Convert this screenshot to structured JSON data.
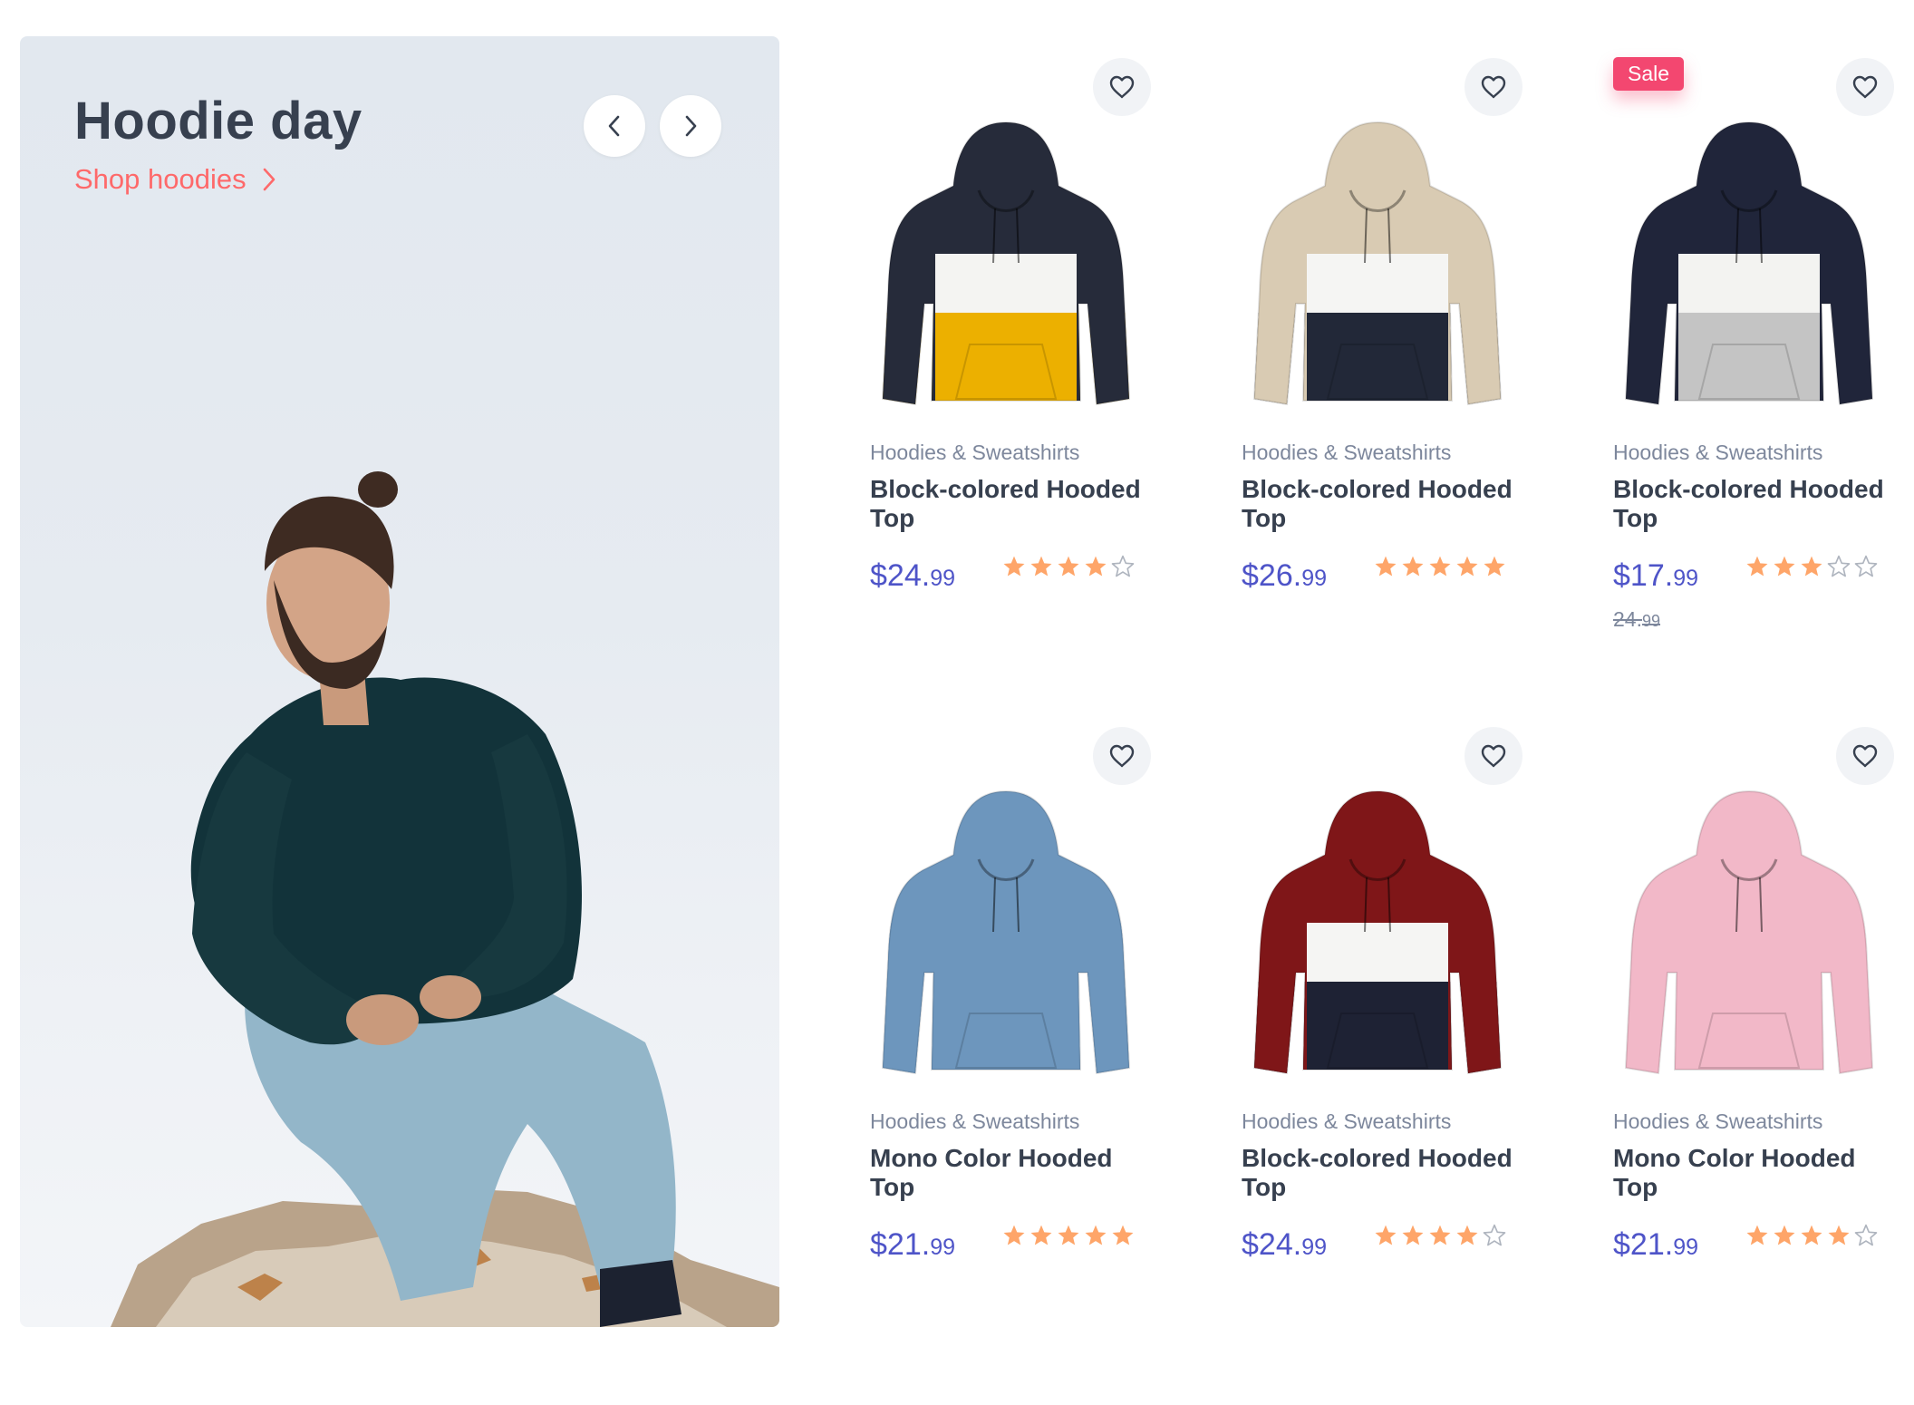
{
  "banner": {
    "title": "Hoodie day",
    "link_label": "Shop hoodies",
    "accent_color": "#fe696a"
  },
  "products": [
    {
      "category": "Hoodies & Sweatshirts",
      "name": "Block-colored Hooded Top",
      "price_main": "$24.",
      "price_cents": "99",
      "rating": 4,
      "sale": false,
      "colors": [
        "#262b3a",
        "#f4f4f2",
        "#ecb000"
      ]
    },
    {
      "category": "Hoodies & Sweatshirts",
      "name": "Block-colored Hooded Top",
      "price_main": "$26.",
      "price_cents": "99",
      "rating": 5,
      "sale": false,
      "colors": [
        "#d9cbb3",
        "#f5f5f3",
        "#222838"
      ]
    },
    {
      "category": "Hoodies & Sweatshirts",
      "name": "Block-colored Hooded Top",
      "price_main": "$17.",
      "price_cents": "99",
      "old_price_main": "24.",
      "old_price_cents": "99",
      "rating": 3,
      "sale": true,
      "sale_label": "Sale",
      "colors": [
        "#20253a",
        "#f3f3f1",
        "#c4c4c4"
      ]
    },
    {
      "category": "Hoodies & Sweatshirts",
      "name": "Mono Color Hooded Top",
      "price_main": "$21.",
      "price_cents": "99",
      "rating": 5,
      "sale": false,
      "colors": [
        "#6d96bd",
        "#6d96bd",
        "#6d96bd"
      ]
    },
    {
      "category": "Hoodies & Sweatshirts",
      "name": "Block-colored Hooded Top",
      "price_main": "$24.",
      "price_cents": "99",
      "rating": 4,
      "sale": false,
      "colors": [
        "#7f1618",
        "#f5f5f3",
        "#1e2234"
      ]
    },
    {
      "category": "Hoodies & Sweatshirts",
      "name": "Mono Color Hooded Top",
      "price_main": "$21.",
      "price_cents": "99",
      "rating": 4,
      "sale": false,
      "colors": [
        "#f2b8c8",
        "#f2b8c8",
        "#f2b8c8"
      ]
    }
  ],
  "theme": {
    "price_color": "#4e54c8",
    "star_color": "#fea569",
    "star_empty_color": "#aeb4be",
    "sale_color": "#f34770"
  }
}
